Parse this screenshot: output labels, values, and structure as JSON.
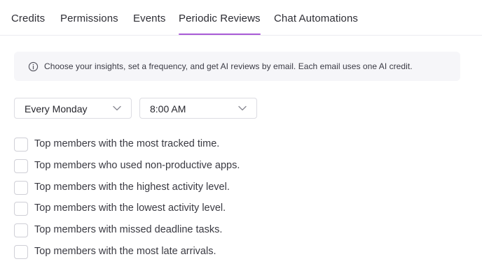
{
  "tabs": [
    {
      "label": "Credits",
      "active": false
    },
    {
      "label": "Permissions",
      "active": false
    },
    {
      "label": "Events",
      "active": false
    },
    {
      "label": "Periodic Reviews",
      "active": true
    },
    {
      "label": "Chat Automations",
      "active": false
    }
  ],
  "accent_color": "#a85ad6",
  "info": {
    "icon": "info-icon",
    "text": "Choose your insights, set a frequency, and get AI reviews by email. Each email uses one AI credit."
  },
  "frequency": {
    "value": "Every Monday"
  },
  "time": {
    "value": "8:00 AM"
  },
  "options": [
    {
      "label": "Top members with the most tracked time.",
      "checked": false
    },
    {
      "label": "Top members who used non-productive apps.",
      "checked": false
    },
    {
      "label": "Top members with the highest activity level.",
      "checked": false
    },
    {
      "label": "Top members with the lowest activity level.",
      "checked": false
    },
    {
      "label": "Top members with missed deadline tasks.",
      "checked": false
    },
    {
      "label": "Top members with the most late arrivals.",
      "checked": false
    }
  ]
}
